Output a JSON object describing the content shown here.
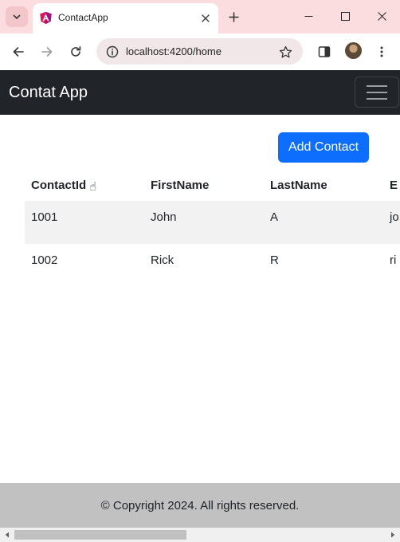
{
  "browser": {
    "tab": {
      "title": "ContactApp"
    },
    "address": {
      "url": "localhost:4200/home"
    },
    "colors": {
      "tabbar": "#fbdde0",
      "omnibox": "#f1e7e8"
    }
  },
  "app": {
    "brand": "Contat App",
    "add_button_label": "Add Contact",
    "table": {
      "headers": [
        "ContactId",
        "FirstName",
        "LastName",
        "E"
      ],
      "header_emoji": "☝",
      "rows": [
        {
          "id": "1001",
          "first": "John",
          "last": "A",
          "email": "jo"
        },
        {
          "id": "1002",
          "first": "Rick",
          "last": "R",
          "email": "ri"
        }
      ]
    },
    "footer": "© Copyright 2024. All rights reserved.",
    "colors": {
      "navbar": "#212529",
      "primary": "#0d6efd",
      "footer": "#c1c1c1",
      "stripe": "#f2f2f2"
    }
  },
  "icons": {
    "tab_search": "chevron-down-icon",
    "favicon": "angular-logo-icon",
    "tab_close": "close-icon",
    "new_tab": "plus-icon",
    "minimize": "minimize-icon",
    "maximize": "maximize-icon",
    "close_window": "close-icon",
    "back": "arrow-left-icon",
    "forward": "arrow-right-icon",
    "reload": "reload-icon",
    "site_info": "info-icon",
    "bookmark": "star-icon",
    "side_panel": "side-panel-icon",
    "menu": "kebab-menu-icon",
    "navbar_toggler": "hamburger-icon"
  }
}
